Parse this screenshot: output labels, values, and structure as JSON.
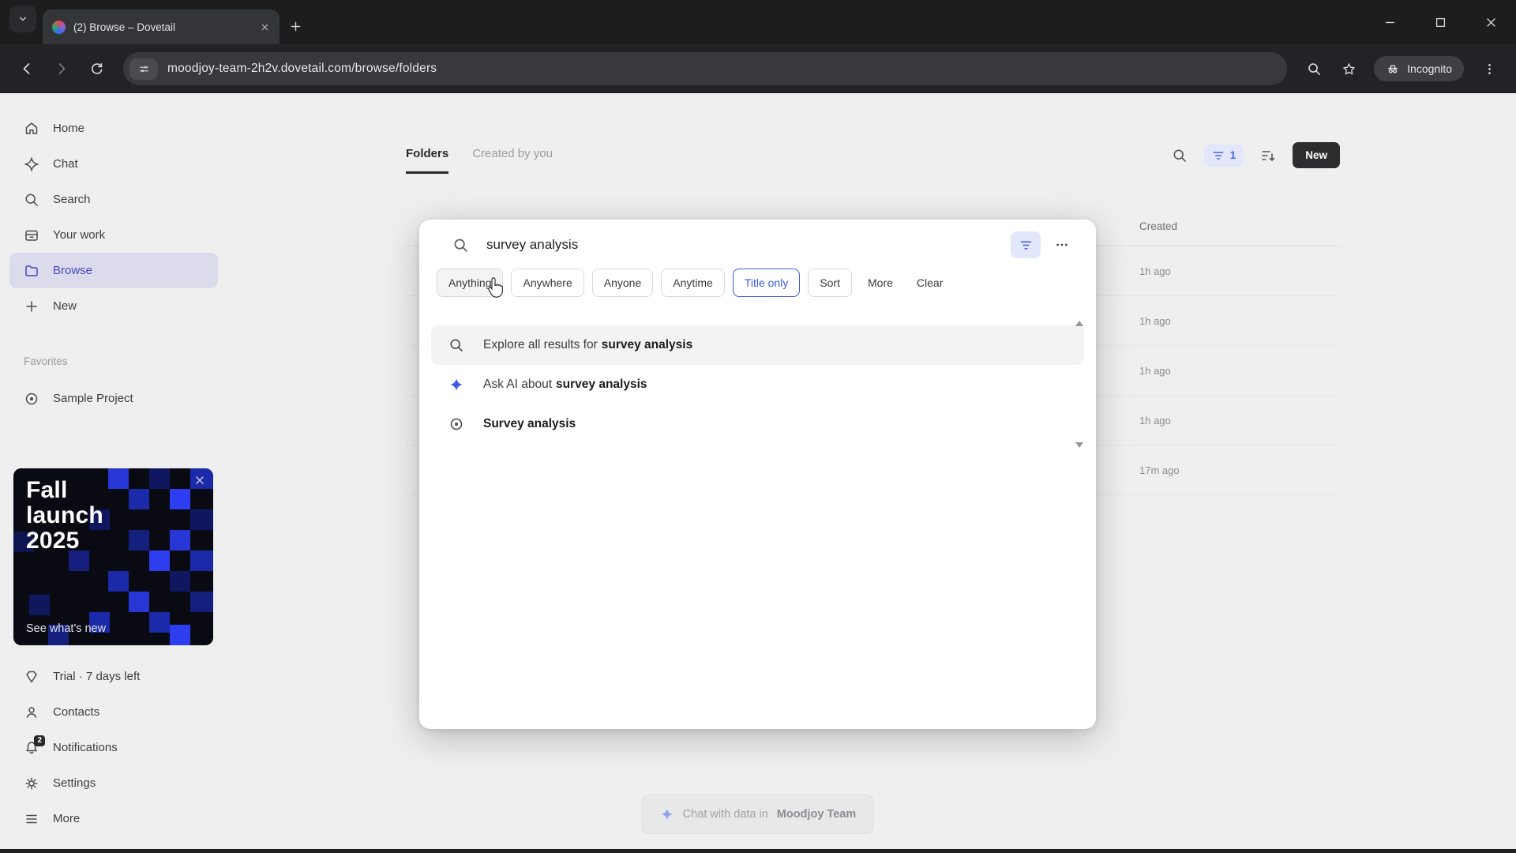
{
  "browser": {
    "tab_title": "(2) Browse – Dovetail",
    "url": "moodjoy-team-2h2v.dovetail.com/browse/folders",
    "incognito_label": "Incognito"
  },
  "sidebar": {
    "items": [
      {
        "label": "Home",
        "icon": "home-icon"
      },
      {
        "label": "Chat",
        "icon": "sparkle-icon"
      },
      {
        "label": "Search",
        "icon": "search-icon"
      },
      {
        "label": "Your work",
        "icon": "work-icon"
      },
      {
        "label": "Browse",
        "icon": "folder-icon",
        "active": true
      },
      {
        "label": "New",
        "icon": "plus-icon"
      }
    ],
    "favorites_header": "Favorites",
    "favorites": [
      {
        "label": "Sample Project",
        "icon": "target-icon"
      }
    ],
    "banner": {
      "line1": "Fall",
      "line2": "launch",
      "line3": "2025",
      "link": "See what's new"
    },
    "footer": [
      {
        "label": "Trial · 7 days left",
        "icon": "gem-icon"
      },
      {
        "label": "Contacts",
        "icon": "person-icon"
      },
      {
        "label": "Notifications",
        "icon": "bell-icon",
        "badge": "2"
      },
      {
        "label": "Settings",
        "icon": "gear-icon"
      },
      {
        "label": "More",
        "icon": "menu-icon"
      }
    ]
  },
  "main": {
    "tabs": [
      {
        "label": "Folders",
        "active": true
      },
      {
        "label": "Created by you",
        "active": false
      }
    ],
    "filter_count": "1",
    "new_button": "New",
    "table": {
      "created_header": "Created",
      "rows": [
        "1h ago",
        "1h ago",
        "1h ago",
        "1h ago",
        "17m ago"
      ]
    },
    "chat_pill": {
      "prefix": "Chat with data in",
      "team": "Moodjoy Team"
    }
  },
  "search_modal": {
    "query": "survey analysis",
    "chips": [
      {
        "label": "Anything",
        "style": "hovered"
      },
      {
        "label": "Anywhere",
        "style": "default"
      },
      {
        "label": "Anyone",
        "style": "default"
      },
      {
        "label": "Anytime",
        "style": "default"
      },
      {
        "label": "Title only",
        "style": "active"
      },
      {
        "label": "Sort",
        "style": "default"
      },
      {
        "label": "More",
        "style": "plain"
      },
      {
        "label": "Clear",
        "style": "plain"
      }
    ],
    "results": [
      {
        "prefix": "Explore all results for",
        "emphasis": "survey analysis",
        "icon": "search-icon"
      },
      {
        "prefix": "Ask AI about",
        "emphasis": "survey analysis",
        "icon": "sparkle-icon"
      },
      {
        "prefix": "",
        "emphasis": "Survey analysis",
        "icon": "target-icon"
      }
    ]
  }
}
